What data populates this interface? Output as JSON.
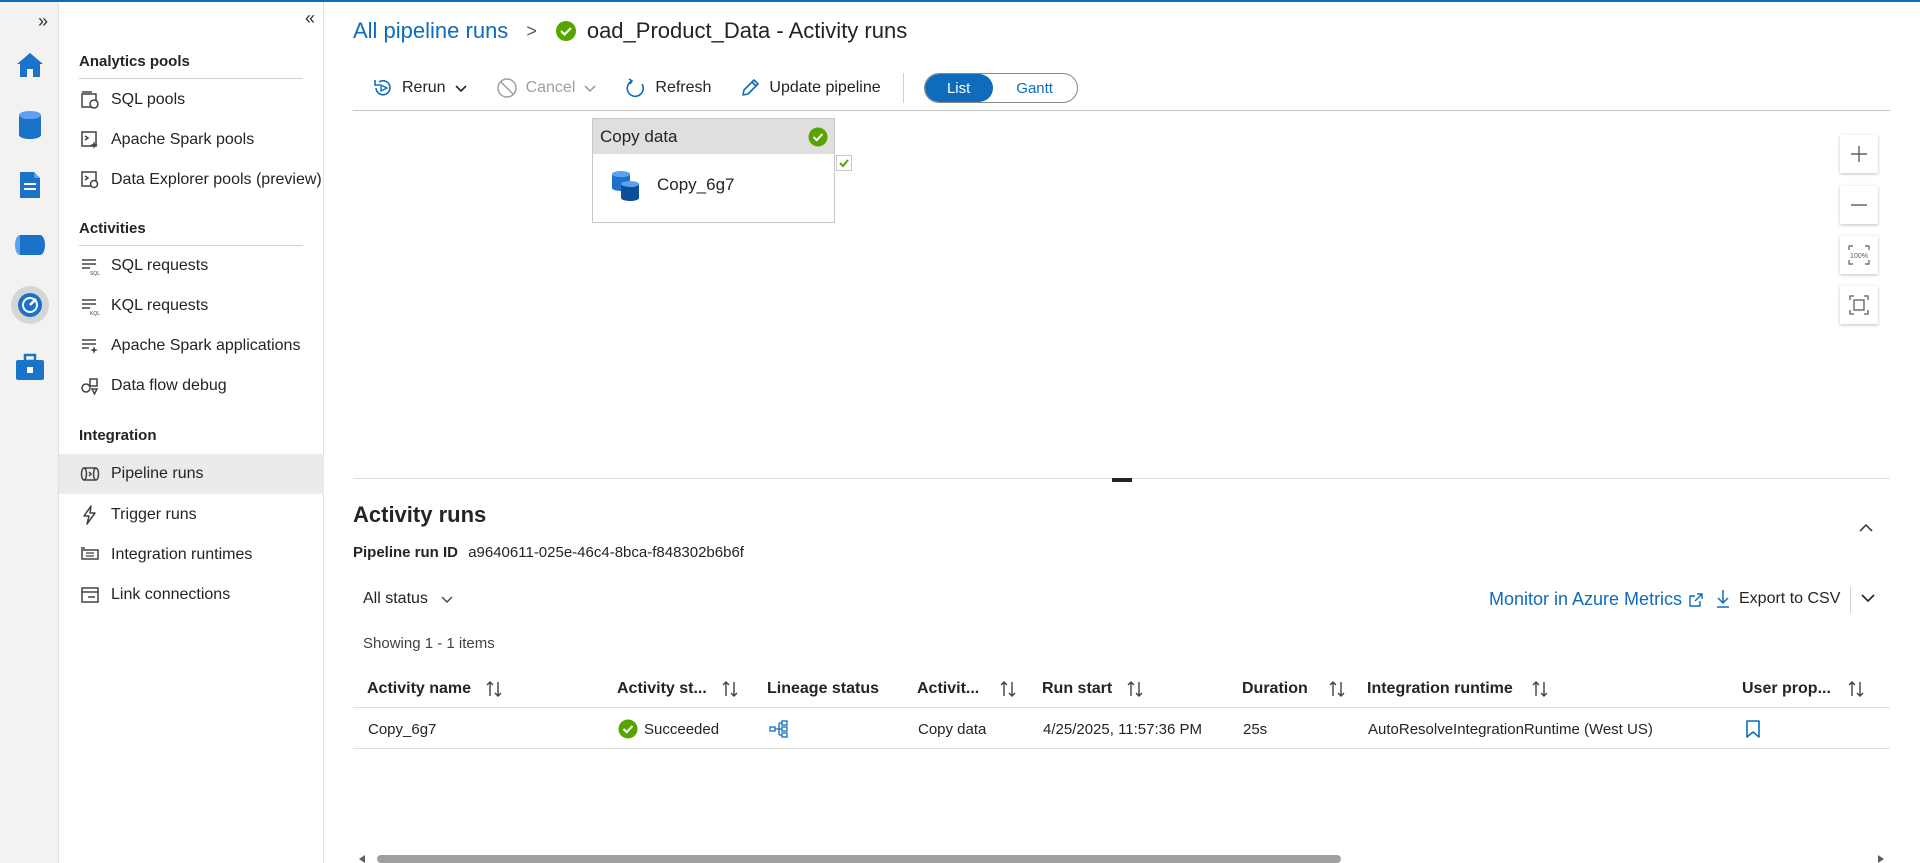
{
  "breadcrumb": {
    "link": "All pipeline runs",
    "separator": ">",
    "title": "oad_Product_Data - Activity runs"
  },
  "menu": {
    "groups": {
      "analytics": "Analytics pools",
      "activities": "Activities",
      "integration": "Integration"
    },
    "items": {
      "sql_pools": "SQL pools",
      "spark_pools": "Apache Spark pools",
      "data_explorer": "Data Explorer pools (preview)",
      "sql_requests": "SQL requests",
      "kql_requests": "KQL requests",
      "spark_apps": "Apache Spark applications",
      "data_flow_debug": "Data flow debug",
      "pipeline_runs": "Pipeline runs",
      "trigger_runs": "Trigger runs",
      "integration_runtimes": "Integration runtimes",
      "link_connections": "Link connections"
    }
  },
  "toolbar": {
    "rerun": "Rerun",
    "cancel": "Cancel",
    "refresh": "Refresh",
    "update_pipeline": "Update pipeline",
    "view_list": "List",
    "view_gantt": "Gantt"
  },
  "canvas": {
    "node_type": "Copy data",
    "node_name": "Copy_6g7"
  },
  "activity_runs": {
    "title": "Activity runs",
    "pipeline_run_id_label": "Pipeline run ID",
    "pipeline_run_id": "a9640611-025e-46c4-8bca-f848302b6b6f",
    "status_filter": "All status",
    "monitor_link": "Monitor in Azure Metrics",
    "export": "Export to CSV",
    "showing": "Showing 1 - 1 items",
    "columns": {
      "activity_name": "Activity name",
      "activity_status": "Activity st...",
      "lineage_status": "Lineage status",
      "activity_type": "Activit...",
      "run_start": "Run start",
      "duration": "Duration",
      "integration_runtime": "Integration runtime",
      "user_properties": "User prop..."
    },
    "rows": [
      {
        "activity_name": "Copy_6g7",
        "status": "Succeeded",
        "activity_type": "Copy data",
        "run_start": "4/25/2025, 11:57:36 PM",
        "duration": "25s",
        "integration_runtime": "AutoResolveIntegrationRuntime (West US)"
      }
    ]
  },
  "colors": {
    "accent": "#0f6cbd",
    "success": "#57a300"
  }
}
